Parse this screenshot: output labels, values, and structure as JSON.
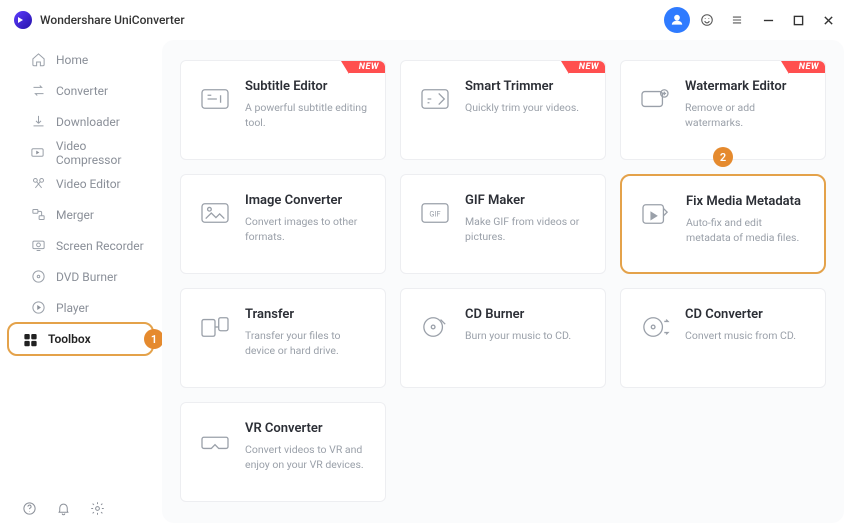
{
  "app": {
    "title": "Wondershare UniConverter"
  },
  "annotations": {
    "sidebar_badge": "1",
    "card_badge": "2"
  },
  "new_tag": "NEW",
  "sidebar": {
    "items": [
      {
        "label": "Home"
      },
      {
        "label": "Converter"
      },
      {
        "label": "Downloader"
      },
      {
        "label": "Video Compressor"
      },
      {
        "label": "Video Editor"
      },
      {
        "label": "Merger"
      },
      {
        "label": "Screen Recorder"
      },
      {
        "label": "DVD Burner"
      },
      {
        "label": "Player"
      },
      {
        "label": "Toolbox"
      }
    ]
  },
  "tools": [
    {
      "title": "Subtitle Editor",
      "desc": "A powerful subtitle editing tool.",
      "new": true
    },
    {
      "title": "Smart Trimmer",
      "desc": "Quickly trim your videos.",
      "new": true
    },
    {
      "title": "Watermark Editor",
      "desc": "Remove or add watermarks.",
      "new": true
    },
    {
      "title": "Image Converter",
      "desc": "Convert images to other formats.",
      "new": false
    },
    {
      "title": "GIF Maker",
      "desc": "Make GIF from videos or pictures.",
      "new": false
    },
    {
      "title": "Fix Media Metadata",
      "desc": "Auto-fix and edit metadata of media files.",
      "new": false
    },
    {
      "title": "Transfer",
      "desc": "Transfer your files to device or hard drive.",
      "new": false
    },
    {
      "title": "CD Burner",
      "desc": "Burn your music to CD.",
      "new": false
    },
    {
      "title": "CD Converter",
      "desc": "Convert music from CD.",
      "new": false
    },
    {
      "title": "VR Converter",
      "desc": "Convert videos to VR and enjoy on your VR devices.",
      "new": false
    }
  ]
}
